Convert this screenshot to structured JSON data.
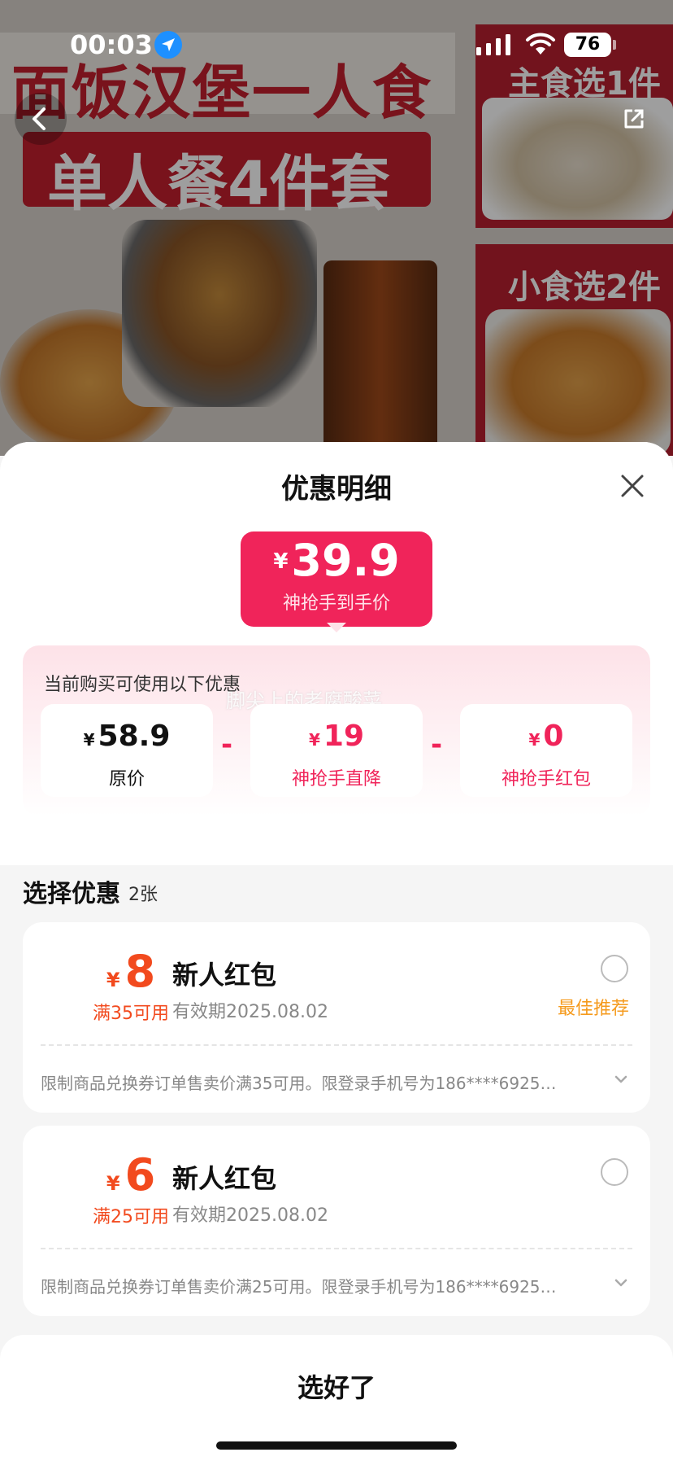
{
  "status_bar": {
    "time": "00:03",
    "battery": "76"
  },
  "hero": {
    "banner_line1": "面饭汉堡一人食",
    "banner_line2": "单人餐4件套",
    "panel1_label": "主食选1件",
    "panel2_label": "小食选2件"
  },
  "sheet": {
    "title": "优惠明细",
    "final_price": {
      "currency": "¥",
      "amount": "39.9",
      "caption": "神抢手到手价"
    },
    "promo": {
      "label": "当前购买可使用以下优惠",
      "watermark": "脚尖上的老腐酸菜",
      "items": [
        {
          "currency": "¥",
          "value": "58.9",
          "label": "原价"
        },
        {
          "currency": "¥",
          "value": "19",
          "label": "神抢手直降"
        },
        {
          "currency": "¥",
          "value": "0",
          "label": "神抢手红包"
        }
      ],
      "operator": "-"
    },
    "section": {
      "title": "选择优惠",
      "count": "2张"
    },
    "coupons": [
      {
        "currency": "¥",
        "amount": "8",
        "condition": "满35可用",
        "title": "新人红包",
        "validity": "有效期2025.08.02",
        "badge": "最佳推荐",
        "rule": "限制商品兑换券订单售卖价满35可用。限登录手机号为186****6925…"
      },
      {
        "currency": "¥",
        "amount": "6",
        "condition": "满25可用",
        "title": "新人红包",
        "validity": "有效期2025.08.02",
        "badge": "",
        "rule": "限制商品兑换券订单售卖价满25可用。限登录手机号为186****6925…"
      }
    ],
    "confirm_label": "选好了"
  },
  "colors": {
    "accent_pink": "#f0245a",
    "coupon_orange": "#f24a1e",
    "best_badge": "#f59a1c"
  },
  "icons": [
    "location-arrow-icon",
    "signal-icon",
    "wifi-icon",
    "battery-icon",
    "back-arrow-icon",
    "share-icon",
    "close-icon",
    "chevron-down-icon"
  ]
}
